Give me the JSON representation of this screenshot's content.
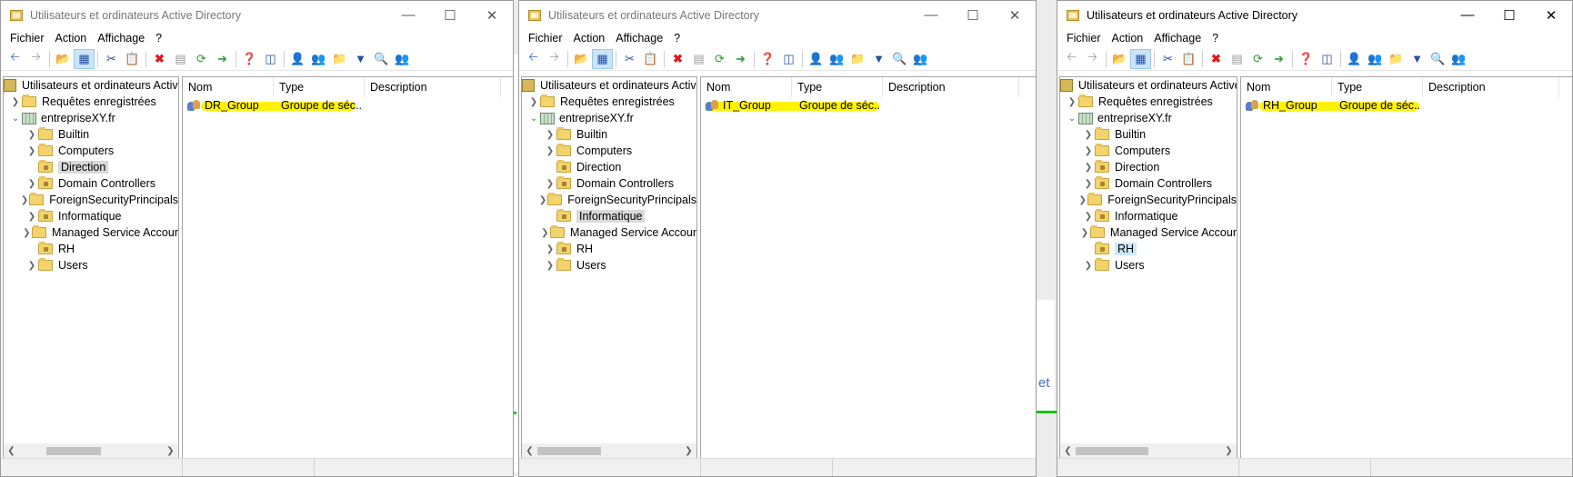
{
  "background": {
    "fragment_text_1": "et"
  },
  "windows": [
    {
      "title": "Utilisateurs et ordinateurs Active Directory",
      "menu": [
        "Fichier",
        "Action",
        "Affichage",
        "?"
      ],
      "tree": {
        "root": "Utilisateurs et ordinateurs Active",
        "saved_queries": "Requêtes enregistrées",
        "domain": "entrepriseXY.fr",
        "children": [
          "Builtin",
          "Computers",
          "Direction",
          "Domain Controllers",
          "ForeignSecurityPrincipals",
          "Informatique",
          "Managed Service Accour",
          "RH",
          "Users"
        ],
        "selected": "Direction"
      },
      "columns": [
        "Nom",
        "Type",
        "Description"
      ],
      "rows": [
        {
          "name": "DR_Group",
          "type": "Groupe de séc..."
        }
      ]
    },
    {
      "title": "Utilisateurs et ordinateurs Active Directory",
      "menu": [
        "Fichier",
        "Action",
        "Affichage",
        "?"
      ],
      "tree": {
        "root": "Utilisateurs et ordinateurs Active",
        "saved_queries": "Requêtes enregistrées",
        "domain": "entrepriseXY.fr",
        "children": [
          "Builtin",
          "Computers",
          "Direction",
          "Domain Controllers",
          "ForeignSecurityPrincipals",
          "Informatique",
          "Managed Service Accour",
          "RH",
          "Users"
        ],
        "selected": "Informatique"
      },
      "columns": [
        "Nom",
        "Type",
        "Description"
      ],
      "rows": [
        {
          "name": "IT_Group",
          "type": "Groupe de séc..."
        }
      ]
    },
    {
      "title": "Utilisateurs et ordinateurs Active Directory",
      "menu": [
        "Fichier",
        "Action",
        "Affichage",
        "?"
      ],
      "tree": {
        "root": "Utilisateurs et ordinateurs Active",
        "saved_queries": "Requêtes enregistrées",
        "domain": "entrepriseXY.fr",
        "children": [
          "Builtin",
          "Computers",
          "Direction",
          "Domain Controllers",
          "ForeignSecurityPrincipals",
          "Informatique",
          "Managed Service Accour",
          "RH",
          "Users"
        ],
        "selected": "RH"
      },
      "columns": [
        "Nom",
        "Type",
        "Description"
      ],
      "rows": [
        {
          "name": "RH_Group",
          "type": "Groupe de séc..."
        }
      ]
    }
  ],
  "colors": {
    "highlight": "#fff200",
    "selection_gray": "#d9d9d9",
    "selection_blue": "#cce8ff",
    "folder": "#f3d36b"
  }
}
